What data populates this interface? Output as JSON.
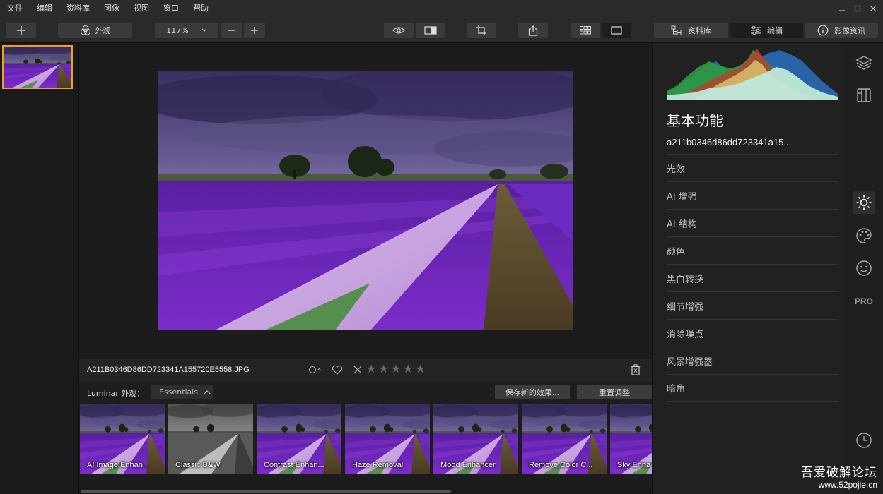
{
  "menu": [
    "文件",
    "编辑",
    "资料库",
    "图像",
    "视图",
    "窗口",
    "帮助"
  ],
  "toolbar": {
    "looks_label": "外观",
    "zoom": "117%",
    "library_tab": "资料库",
    "edit_tab": "编辑",
    "info_tab": "影像资讯"
  },
  "photo": {
    "filename": "A211B0346D86DD723341A155720E5558.JPG"
  },
  "rating": {
    "stars_total": 5,
    "stars_filled": 0
  },
  "looks": {
    "label": "Luminar 外观：",
    "category": "Essentials",
    "save_button": "保存新的效果...",
    "reset_button": "重置调整",
    "items": [
      {
        "label": "AI Image Enhan...",
        "style": "color"
      },
      {
        "label": "Classic B&W",
        "style": "bw"
      },
      {
        "label": "Contrast Enhan...",
        "style": "color"
      },
      {
        "label": "Haze Removal",
        "style": "color"
      },
      {
        "label": "Mood Enhancer",
        "style": "color"
      },
      {
        "label": "Remove Color C...",
        "style": "color"
      },
      {
        "label": "Sky Enha",
        "style": "color"
      }
    ]
  },
  "panel": {
    "title": "基本功能",
    "filename": "a211b0346d86dd723341a15...",
    "tools": [
      "光效",
      "AI 增强",
      "AI 结构",
      "颜色",
      "黑白转换",
      "细节增强",
      "消除噪点",
      "风景增强器",
      "暗角"
    ]
  },
  "sidebar_icons": [
    "layers-icon",
    "canvas-icon",
    "essentials-sun-icon",
    "creative-palette-icon",
    "portrait-face-icon",
    "pro-icon",
    "history-clock-icon"
  ],
  "pro_label": "PRO",
  "watermark": {
    "line1": "吾爱破解论坛",
    "line2": "www.52pojie.cn"
  },
  "colors": {
    "accent_orange": "#f0a020",
    "background": "#1c1c1c",
    "panel": "#212121"
  }
}
